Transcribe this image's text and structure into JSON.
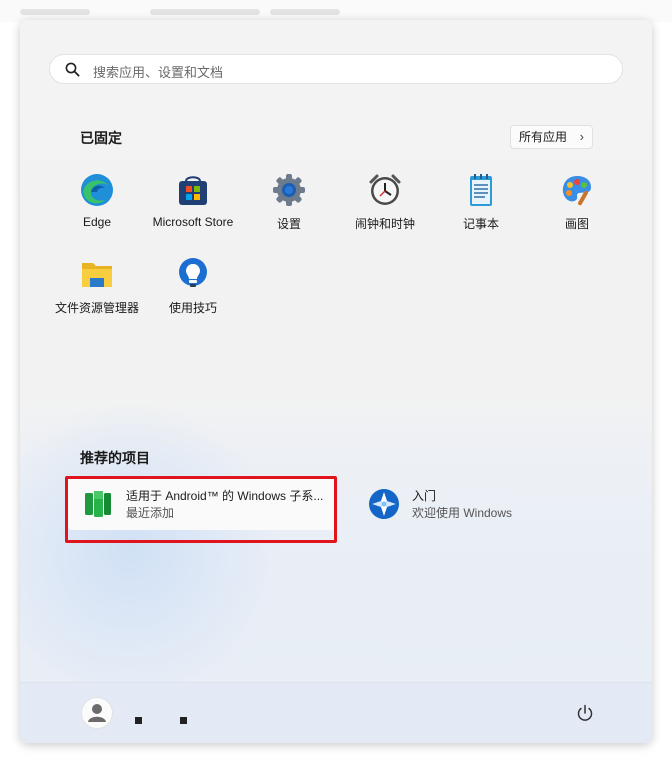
{
  "search": {
    "placeholder": "搜索应用、设置和文档",
    "icon": "search-icon"
  },
  "pinned": {
    "title": "已固定",
    "all_apps_label": "所有应用",
    "apps": [
      {
        "label": "Edge",
        "icon": "edge-icon"
      },
      {
        "label": "Microsoft Store",
        "icon": "store-icon"
      },
      {
        "label": "设置",
        "icon": "settings-gear-icon"
      },
      {
        "label": "闹钟和时钟",
        "icon": "alarm-clock-icon"
      },
      {
        "label": "记事本",
        "icon": "notepad-icon"
      },
      {
        "label": "画图",
        "icon": "paint-palette-icon"
      },
      {
        "label": "文件资源管理器",
        "icon": "folder-icon"
      },
      {
        "label": "使用技巧",
        "icon": "tips-bulb-icon"
      }
    ]
  },
  "recommended": {
    "title": "推荐的项目",
    "items": [
      {
        "title": "适用于 Android™ 的 Windows 子系...",
        "subtitle": "最近添加",
        "icon": "android-subsystem-icon"
      },
      {
        "title": "入门",
        "subtitle": "欢迎使用 Windows",
        "icon": "get-started-icon"
      }
    ]
  },
  "footer": {
    "user_icon": "user-avatar-icon",
    "power_icon": "power-icon"
  },
  "colors": {
    "highlight_border": "#e0141c",
    "panel_bg": "#f3f3f3"
  }
}
